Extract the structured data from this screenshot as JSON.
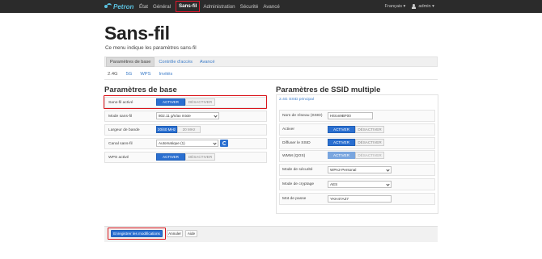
{
  "nav": {
    "logo": "Petron",
    "items": [
      {
        "label": "État"
      },
      {
        "label": "Général"
      },
      {
        "label": "Sans-fil"
      },
      {
        "label": "Administration"
      },
      {
        "label": "Sécurité"
      },
      {
        "label": "Avancé"
      }
    ],
    "language": "Français",
    "user": "admin"
  },
  "header": {
    "title": "Sans-fil",
    "subtitle": "Ce menu indique les paramètres sans-fil"
  },
  "subtabs": [
    "Paramètres de base",
    "Contrôle d'accès",
    "Avancé"
  ],
  "bandtabs": [
    "2.4G",
    "5G",
    "WPS",
    "Invités"
  ],
  "basic": {
    "heading": "Paramètres de base",
    "rows": {
      "wifi_enabled": {
        "label": "Sans-fil activé",
        "on": "ACTIVER",
        "off": "DÉSACTIVER"
      },
      "mode": {
        "label": "Mode sans-fil",
        "value": "802.11 g/n/ax mixte"
      },
      "bandwidth": {
        "label": "Largeur de bande",
        "on": "20/40 MHz",
        "off": "20 MHz"
      },
      "channel": {
        "label": "Canal sans-fil",
        "value": "Automatique (1)"
      },
      "wps": {
        "label": "WPS activé",
        "on": "ACTIVER",
        "off": "DÉSACTIVER"
      }
    }
  },
  "ssid": {
    "heading": "Paramètres de SSID multiple",
    "tab": "2.4G SSID principal",
    "rows": {
      "name": {
        "label": "Nom de réseau (SSID)",
        "value": "Hitron9BF00"
      },
      "activate": {
        "label": "Activer",
        "on": "ACTIVER",
        "off": "DÉSACTIVER"
      },
      "broadcast": {
        "label": "Diffuser le SSID",
        "on": "ACTIVER",
        "off": "DÉSACTIVER"
      },
      "wmm": {
        "label": "WMM (QOS)",
        "on": "ACTIVER",
        "off": "DÉSACTIVER"
      },
      "security": {
        "label": "Mode de sécurité",
        "value": "WPA2-Personal"
      },
      "encryption": {
        "label": "Mode de cryptage",
        "value": "AES"
      },
      "password": {
        "label": "Mot de passe",
        "value": "YKH47AZ7"
      }
    }
  },
  "actions": {
    "save": "Enregistrer les modifications",
    "cancel": "Annuler",
    "help": "Aide"
  },
  "colors": {
    "accent": "#2a6fd0",
    "highlight": "#d9151b",
    "topbar": "#2b2b2b"
  }
}
